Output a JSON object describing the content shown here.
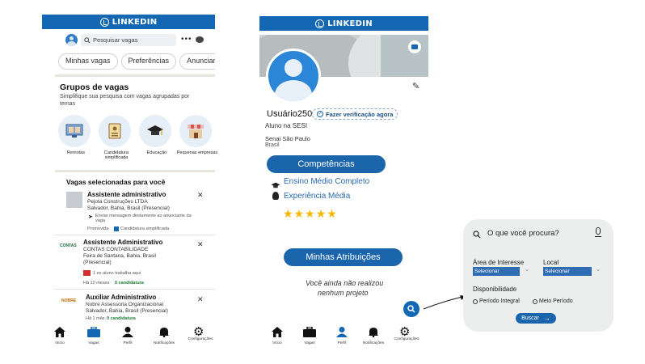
{
  "left_screen": {
    "brand": "LINKEDIN",
    "search_placeholder": "Pesquisar vagas",
    "chips": [
      "Minhas vagas",
      "Preferências",
      "Anunciar va"
    ],
    "groups_title": "Grupos de vagas",
    "groups_subtitle": "Simplifique sua pesquisa com vagas agrupadas por temas",
    "categories": [
      "Remotas",
      "Candidatura simplificada",
      "Educação",
      "Pequenas empresas"
    ],
    "section_title": "Vagas selecionadas para você",
    "jobs": [
      {
        "title": "Assistente administrativo",
        "company": "Pejota Construções LTDA",
        "location": "Salvador, Bahia, Brasil (Presencial)",
        "message": "Enviar mensagem diretamente ao anunciante da vaga",
        "promo": "Promovida",
        "easy": "Candidatura simplificada"
      },
      {
        "title": "Assistente Administrativo",
        "company": "CONTAS CONTABILIDADE",
        "location": "Feira de Santana, Bahia, Brasil (Presencial)",
        "alumni": "1 ex-aluno trabalha aqui",
        "age": "Há 10 meses",
        "applicants": "0 candidatura",
        "logo_text": "CONTAS"
      },
      {
        "title": "Auxiliar Administrativo",
        "company": "Nobre Assessoria Organizacional",
        "location": "Salvador, Bahia, Brasil (Presencial)",
        "age": "Há 1 mês",
        "applicants": "0 candidatura",
        "logo_text": "NOBRE"
      }
    ],
    "nav": [
      "Início",
      "Vagas",
      "Perfil",
      "Notificações",
      "Configurações"
    ]
  },
  "right_screen": {
    "brand": "LINKEDIN",
    "username": "Usuário250",
    "verify_label": "Fazer verificação agora",
    "headline": "Aluno na SESI",
    "school": "Senai São Paulo",
    "country": "Brasil",
    "skills_label": "Competências",
    "skills": [
      "Ensino Médio Completo",
      "Experiência Média"
    ],
    "rating": 5,
    "assignments_label": "Minhas Atribuições",
    "empty_line1": "Você ainda não realizou",
    "empty_line2": "nenhum projeto",
    "nav": [
      "Início",
      "Vagas",
      "Perfil",
      "Notificações",
      "Configurações"
    ]
  },
  "search_panel": {
    "placeholder": "O que você procura?",
    "interest_label": "Área de Interesse",
    "interest_value": "Selecionar",
    "local_label": "Local",
    "local_value": "Selecionar",
    "availability_label": "Disponibilidade",
    "options": [
      "Período Integral",
      "Meio Período"
    ],
    "search_button": "Buscar"
  },
  "colors": {
    "brand_blue": "#1468b3",
    "pill_blue": "#1b65ad",
    "star": "#f5b800",
    "panel_bg": "#eceeee"
  }
}
